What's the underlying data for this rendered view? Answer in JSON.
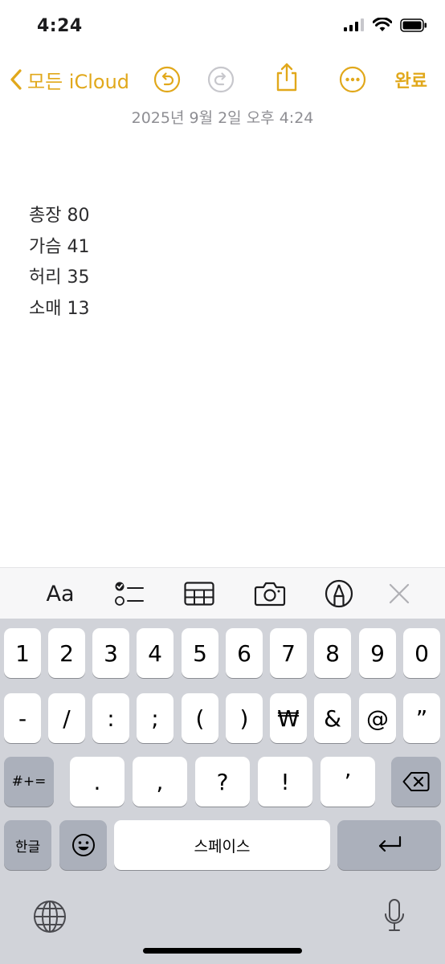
{
  "status": {
    "time": "4:24"
  },
  "nav": {
    "back_label": "모든 iCloud",
    "done_label": "완료"
  },
  "note": {
    "date": "2025년 9월 2일 오후 4:24",
    "lines": [
      "총장 80",
      "가슴 41",
      "허리 35",
      "소매 13"
    ]
  },
  "format_bar": {
    "text_style_label": "Aa"
  },
  "keyboard": {
    "row1": [
      "1",
      "2",
      "3",
      "4",
      "5",
      "6",
      "7",
      "8",
      "9",
      "0"
    ],
    "row2": [
      "-",
      "/",
      ":",
      ";",
      "(",
      ")",
      "₩",
      "&",
      "@",
      "”"
    ],
    "row3_left": "#+=",
    "row3": [
      ".",
      ",",
      "?",
      "!",
      "’"
    ],
    "lang_label": "한글",
    "space_label": "스페이스"
  },
  "colors": {
    "accent": "#e1a81b",
    "disabled": "#c7c7cc"
  }
}
